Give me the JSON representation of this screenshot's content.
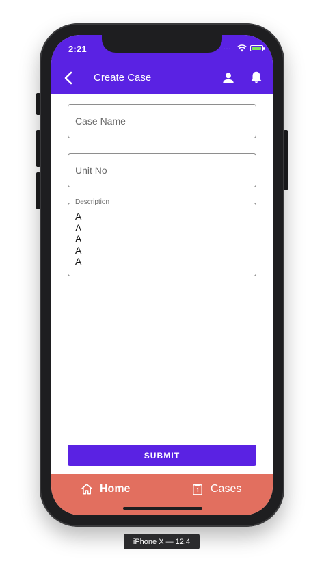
{
  "status_bar": {
    "time": "2:21",
    "signal": "...."
  },
  "header": {
    "title": "Create Case"
  },
  "form": {
    "case_name": {
      "placeholder": "Case Name",
      "value": ""
    },
    "unit_no": {
      "placeholder": "Unit No",
      "value": ""
    },
    "description": {
      "label": "Description",
      "lines": [
        "A",
        "A",
        "A",
        "A",
        "A"
      ]
    }
  },
  "submit_label": "SUBMIT",
  "tabs": [
    {
      "label": "Home",
      "icon": "home-icon",
      "active": true
    },
    {
      "label": "Cases",
      "icon": "clipboard-icon",
      "active": false
    }
  ],
  "device_caption": "iPhone X — 12.4",
  "colors": {
    "primary": "#5a22e3",
    "tabbar": "#e26f5f",
    "battery": "#7ee25a"
  }
}
